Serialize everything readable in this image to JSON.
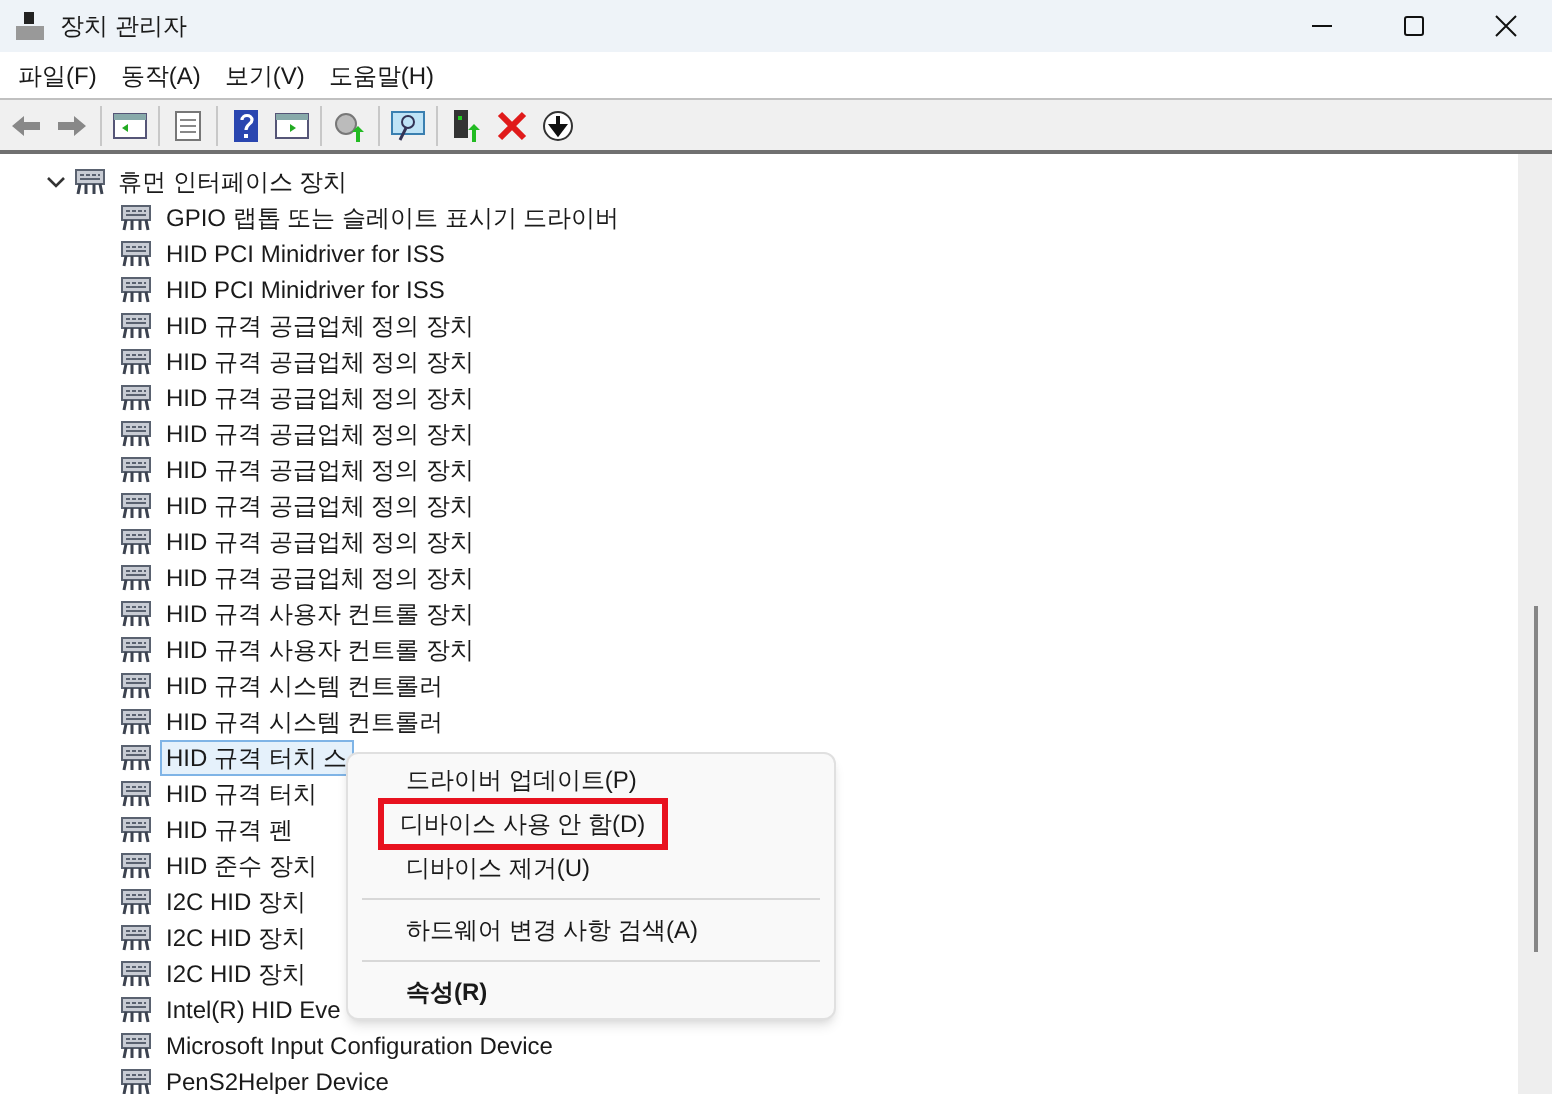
{
  "window": {
    "title": "장치 관리자"
  },
  "menu": [
    "파일(F)",
    "동작(A)",
    "보기(V)",
    "도움말(H)"
  ],
  "tree": {
    "label": "휴먼 인터페이스 장치",
    "expanded": true,
    "children": [
      {
        "label": "GPIO 랩톱 또는 슬레이트 표시기 드라이버",
        "selected": false
      },
      {
        "label": "HID PCI Minidriver for ISS",
        "selected": false
      },
      {
        "label": "HID PCI Minidriver for ISS",
        "selected": false
      },
      {
        "label": "HID 규격 공급업체 정의 장치",
        "selected": false
      },
      {
        "label": "HID 규격 공급업체 정의 장치",
        "selected": false
      },
      {
        "label": "HID 규격 공급업체 정의 장치",
        "selected": false
      },
      {
        "label": "HID 규격 공급업체 정의 장치",
        "selected": false
      },
      {
        "label": "HID 규격 공급업체 정의 장치",
        "selected": false
      },
      {
        "label": "HID 규격 공급업체 정의 장치",
        "selected": false
      },
      {
        "label": "HID 규격 공급업체 정의 장치",
        "selected": false
      },
      {
        "label": "HID 규격 공급업체 정의 장치",
        "selected": false
      },
      {
        "label": "HID 규격 사용자 컨트롤 장치",
        "selected": false
      },
      {
        "label": "HID 규격 사용자 컨트롤 장치",
        "selected": false
      },
      {
        "label": "HID 규격 시스템 컨트롤러",
        "selected": false
      },
      {
        "label": "HID 규격 시스템 컨트롤러",
        "selected": false
      },
      {
        "label": "HID 규격 터치 스",
        "selected": true
      },
      {
        "label": "HID 규격 터치",
        "selected": false
      },
      {
        "label": "HID 규격 펜",
        "selected": false
      },
      {
        "label": "HID 준수 장치",
        "selected": false
      },
      {
        "label": "I2C HID 장치",
        "selected": false
      },
      {
        "label": "I2C HID 장치",
        "selected": false
      },
      {
        "label": "I2C HID 장치",
        "selected": false
      },
      {
        "label": "Intel(R) HID Eve",
        "selected": false
      },
      {
        "label": "Microsoft Input Configuration Device",
        "selected": false
      },
      {
        "label": "PenS2Helper Device",
        "selected": false
      }
    ]
  },
  "context_menu": [
    {
      "kind": "item",
      "label": "드라이버 업데이트(P)",
      "highlighted": false
    },
    {
      "kind": "item",
      "label": "디바이스 사용 안 함(D)",
      "highlighted": true
    },
    {
      "kind": "item",
      "label": "디바이스 제거(U)",
      "highlighted": false
    },
    {
      "kind": "separator"
    },
    {
      "kind": "item",
      "label": "하드웨어 변경 사항 검색(A)",
      "highlighted": false
    },
    {
      "kind": "separator"
    },
    {
      "kind": "bold",
      "label": "속성(R)",
      "highlighted": false
    }
  ]
}
